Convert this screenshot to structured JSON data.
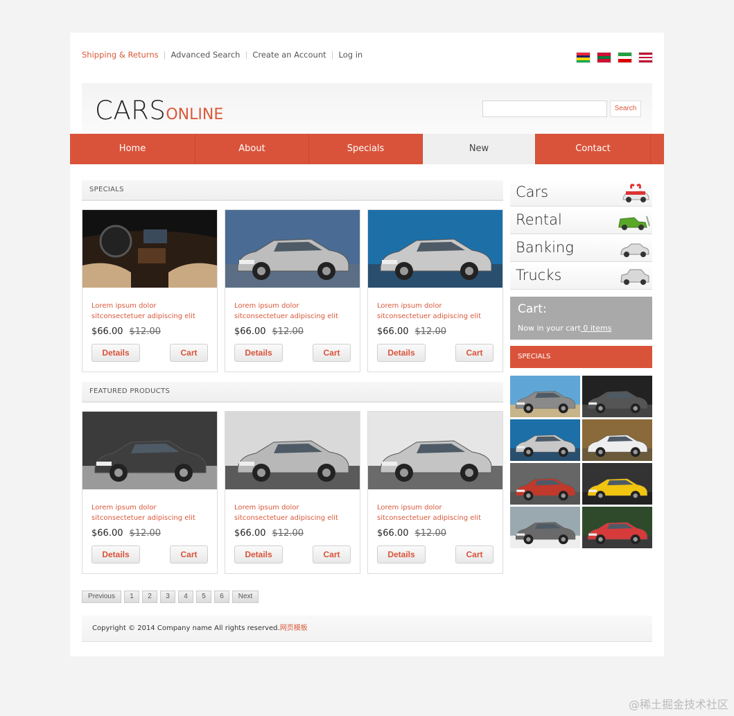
{
  "top_links": [
    "Shipping & Returns",
    "Advanced Search",
    "Create an Account",
    "Log in"
  ],
  "flags": [
    {
      "name": "flag-mauritius",
      "colors": [
        "#ea2839",
        "#1a206d",
        "#ffd500",
        "#00a551"
      ]
    },
    {
      "name": "flag-maldives",
      "colors": [
        "#d21034",
        "#007e3a",
        "#d21034"
      ]
    },
    {
      "name": "flag-iran",
      "colors": [
        "#239f40",
        "#ffffff",
        "#da0000"
      ]
    },
    {
      "name": "flag-liberia",
      "colors": [
        "#bf0a30",
        "#ffffff",
        "#bf0a30",
        "#ffffff",
        "#bf0a30"
      ]
    }
  ],
  "logo": {
    "main": "CARS",
    "accent": "ONLINE"
  },
  "search": {
    "placeholder": "",
    "button": "Search"
  },
  "nav": [
    {
      "label": "Home",
      "active": false
    },
    {
      "label": "About",
      "active": false
    },
    {
      "label": "Specials",
      "active": false
    },
    {
      "label": "New",
      "active": true
    },
    {
      "label": "Contact",
      "active": false
    }
  ],
  "sections": {
    "specials": "SPECIALS",
    "featured": "FEATURED PRODUCTS"
  },
  "product": {
    "desc": "Lorem ipsum dolor sitconsectetuer adipiscing elit",
    "price": "$66.00",
    "old_price": "$12.00",
    "details_label": "Details",
    "cart_label": "Cart"
  },
  "pager": [
    "Previous",
    "1",
    "2",
    "3",
    "4",
    "5",
    "6",
    "Next"
  ],
  "footer": {
    "text": "Copyright © 2014 Company name All rights reserved.",
    "link": "网页模板"
  },
  "categories": [
    "Cars",
    "Rental",
    "Banking",
    "Trucks"
  ],
  "cart": {
    "title": "Cart:",
    "text": "Now in your cart",
    "link": " 0 items"
  },
  "sidebar_specials": "SPECIALS",
  "watermark": "@稀土掘金技术社区",
  "colors": {
    "accent": "#d9533a",
    "accent_text": "#d9593a"
  }
}
